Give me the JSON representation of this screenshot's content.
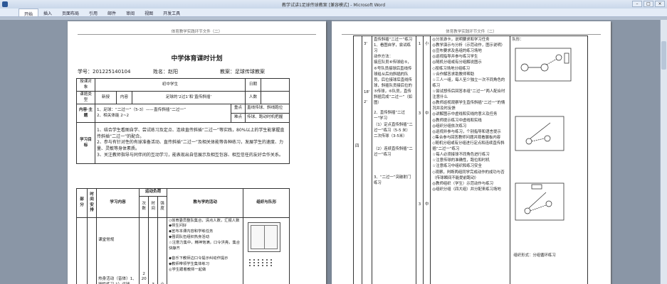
{
  "window": {
    "title": "教学试讲1足球传球教案 [兼容模式] - Microsoft Word",
    "tabs": [
      "开始",
      "插入",
      "页面布局",
      "引用",
      "邮件",
      "审阅",
      "视图",
      "开发工具"
    ]
  },
  "header_text": "体育教学实践环节文件（二）",
  "doc": {
    "title": "中学体育课时计划",
    "student_id": "学号：201225140104",
    "name": "姓名：赵阳",
    "content": "教案：足球传球教案"
  },
  "table": {
    "object_label": "授课对象",
    "object_value": "初中学生",
    "date_label": "日期",
    "type_label": "课题类型",
    "type_value": "新授",
    "content_label": "内容",
    "content_value": "足球的‘2过1’和‘直传斜插’",
    "count_label": "人数",
    "main_label": "内容·主题",
    "main_1": "1、足球：“二过一”（5-3）——直传斜插“二过一”",
    "main_2": "2、相关体能 2~2",
    "key_label": "重点",
    "key_value": "直线传球、斜线跑位",
    "diff_label": "难点",
    "diff_value": "传球、跑动时机把握",
    "goal_label": "学习目标",
    "goal_1": "1、结合学生看图自学、尝试练习及定点、连续直传斜插“二过一”等实践，80%以上的学生能掌握直传斜插“二过一”的配合。",
    "goal_2": "2、参与有针对性的有球准备活动、直传斜插“二过一”及相关体能等各种练习，发展学生的速度、力量、灵敏等身体素质。",
    "goal_3": "3、关注教师指导与同伴间的互动学习，能表现出自信展示及相互包容、相互信任的友好合作关系。",
    "col_part": "部分",
    "col_time": "时间安排",
    "col_study": "学习内容",
    "col_load": "运动负荷",
    "col_times": "次数",
    "col_dur": "时间",
    "col_int": "强度",
    "col_method": "教与学的活动",
    "col_org": "组织与队形",
    "row_study_a": "课堂常规",
    "row_study_b": "热身活动（音体）1、球性练习 1）运球跑，踩球，拉球转身",
    "row_times_a": "2",
    "row_times_b": "20—30",
    "row_dur": "3",
    "row_dur_b": "1",
    "row_int": "小",
    "row_int_b": "中",
    "method_1": "◇体育委员整队集合，清点人数，汇报人数",
    "method_2": "◆师生问好",
    "method_3": "◆宣布本课内容和学练任务",
    "method_4": "◆强调队伍组织热身活动",
    "method_5": "☆注意力集中，精神饱满，口令洪亮，集合快静齐",
    "method_6": "◆音乐下教师边口令提示纠动作提示",
    "method_7": "◆教师带领学生集体练习",
    "method_8": "◎学生跟着教师一起做"
  },
  "right": {
    "col1_items": [
      "3'",
      "3'",
      "3'",
      "18'",
      "2'"
    ],
    "roman": "四",
    "study_1": "直传斜插“二过一”练习",
    "study_2": "1、看图自学，尝试练习",
    "study_3": "动作方法：",
    "study_4": "接应队员⑥传球给⑤，⑥号队员接球后直线传球给从后向斜插的队员，后位接球后直线传球，斜插队员接后位的⑤传球，⑥队员，直传斜插完成“二过一”（如图）",
    "study_5": "2、直传斜插“二过一”学习",
    "study_6": "（1）定点直传斜插“二过一”练习（5-5 米）",
    "study_7": "二次传球（3-5米）",
    "study_8": "（2）连续直传斜插“二过一”练习",
    "study_9": "3、“二过一”突破射门练习",
    "nums_a": [
      "1",
      "3",
      "3"
    ],
    "nums_b": [
      "中",
      "中",
      "小"
    ],
    "m_1": "◎分发游卡，说明要求和学习任务",
    "m_2": "◎教学演示与分析（示范动作，图示说明）",
    "m_3": "◎宣布要求及各组的练习场地",
    "m_4": "◎巡视指导并参与练习学生",
    "m_5": "◎随机分组或有分组解说图示",
    "m_6": "◇按练习场地分组练习",
    "m_7": "☆合作解答求助教师帮助",
    "m_8": "☆三人一组，每人至少独立一次不同角色的练习",
    "m_9": "☆尝试想传后回答本组“二过一”两人配合时注意什么",
    "m_10": "◎教师巡视观察学生直传斜插“二过一”的情况并及时反馈",
    "m_11": "◎讲解图示中虚线和实线的意义及任务",
    "m_12": "◎教师提示练习中虚线和实线",
    "m_13": "◎组织分组依次练习",
    "m_14": "◎巡视并参与练习，个别指导和语言提示",
    "m_15": "◇集合参与回答教师问题并观看展板内容",
    "m_16": "◇随机分组或有分组进行定点和连续直传斜插“二过一”练习",
    "m_17": "☆每人必须接球不同角色进行练习",
    "m_18": "☆注意传球的准确性，跑位和时机",
    "m_19": "☆注意练习中组织和练习安全",
    "m_20": "◇观察，判断两组同学完成动作的成功与否（传球瞬间不能提前跑动）",
    "m_21": "◎教师组织（学生）示范动作与练习",
    "m_22": "◎组织分组（四大组）并分配来练习场地",
    "org_title": "队形：",
    "org_caption": "组织形式：分组循环练习"
  }
}
